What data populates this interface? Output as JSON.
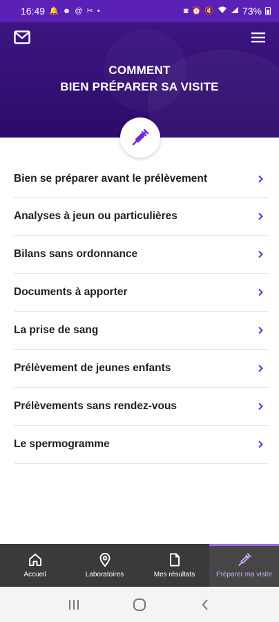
{
  "status_bar": {
    "time": "16:49",
    "battery": "73%",
    "left_icons": [
      "alarm-icon",
      "face-icon",
      "at-icon",
      "scissors-icon",
      "dot-icon"
    ],
    "right_icons": [
      "nfc-icon",
      "alarm-clock-icon",
      "mute-icon",
      "wifi-icon",
      "signal-icon"
    ]
  },
  "header": {
    "title_line1": "COMMENT",
    "title_line2": "BIEN PRÉPARER SA VISITE",
    "badge_icon": "syringe-icon",
    "colors": {
      "hero": "#2c0b69",
      "accent": "#6d28d9"
    }
  },
  "list": {
    "items": [
      {
        "label": "Bien se préparer avant le prélèvement"
      },
      {
        "label": "Analyses à jeun ou particulières"
      },
      {
        "label": "Bilans sans ordonnance"
      },
      {
        "label": "Documents à apporter"
      },
      {
        "label": "La prise de sang"
      },
      {
        "label": "Prélèvement de jeunes enfants"
      },
      {
        "label": "Prélèvements sans rendez-vous"
      },
      {
        "label": "Le spermogramme"
      }
    ]
  },
  "bottom_nav": {
    "tabs": [
      {
        "label": "Accueil",
        "icon": "home-icon"
      },
      {
        "label": "Laboratoires",
        "icon": "location-pin-icon"
      },
      {
        "label": "Mes résultats",
        "icon": "document-icon"
      },
      {
        "label": "Préparer ma visite",
        "icon": "syringe-icon",
        "active": true
      }
    ]
  }
}
